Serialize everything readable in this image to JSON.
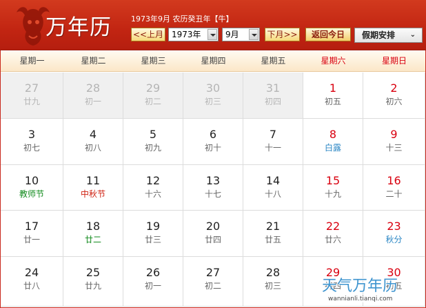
{
  "header": {
    "logo_text": "万年历",
    "ganzhi_text": "1973年9月 农历癸丑年【牛】",
    "prev_month_label": "<<上月",
    "year_value": "1973年",
    "month_value": "9月",
    "next_month_label": "下月>>",
    "today_label": "返回今日",
    "holiday_label": "假期安排",
    "holiday_caret": "⌄"
  },
  "weekdays": [
    "星期一",
    "星期二",
    "星期三",
    "星期四",
    "星期五",
    "星期六",
    "星期日"
  ],
  "weeks": [
    [
      {
        "num": "27",
        "lunar": "廿九"
      },
      {
        "num": "28",
        "lunar": "初一"
      },
      {
        "num": "29",
        "lunar": "初二"
      },
      {
        "num": "30",
        "lunar": "初三"
      },
      {
        "num": "31",
        "lunar": "初四"
      },
      {
        "num": "1",
        "lunar": "初五"
      },
      {
        "num": "2",
        "lunar": "初六"
      }
    ],
    [
      {
        "num": "3",
        "lunar": "初七"
      },
      {
        "num": "4",
        "lunar": "初八"
      },
      {
        "num": "5",
        "lunar": "初九"
      },
      {
        "num": "6",
        "lunar": "初十"
      },
      {
        "num": "7",
        "lunar": "十一"
      },
      {
        "num": "8",
        "lunar": "白露"
      },
      {
        "num": "9",
        "lunar": "十三"
      }
    ],
    [
      {
        "num": "10",
        "lunar": "教师节"
      },
      {
        "num": "11",
        "lunar": "中秋节"
      },
      {
        "num": "12",
        "lunar": "十六"
      },
      {
        "num": "13",
        "lunar": "十七"
      },
      {
        "num": "14",
        "lunar": "十八"
      },
      {
        "num": "15",
        "lunar": "十九"
      },
      {
        "num": "16",
        "lunar": "二十"
      }
    ],
    [
      {
        "num": "17",
        "lunar": "廿一"
      },
      {
        "num": "18",
        "lunar": "廿二"
      },
      {
        "num": "19",
        "lunar": "廿三"
      },
      {
        "num": "20",
        "lunar": "廿四"
      },
      {
        "num": "21",
        "lunar": "廿五"
      },
      {
        "num": "22",
        "lunar": "廿六"
      },
      {
        "num": "23",
        "lunar": "秋分"
      }
    ],
    [
      {
        "num": "24",
        "lunar": "廿八"
      },
      {
        "num": "25",
        "lunar": "廿九"
      },
      {
        "num": "26",
        "lunar": "初一"
      },
      {
        "num": "27",
        "lunar": "初二"
      },
      {
        "num": "28",
        "lunar": "初三"
      },
      {
        "num": "29",
        "lunar": "初四"
      },
      {
        "num": "30",
        "lunar": "初五"
      }
    ]
  ],
  "watermark": {
    "title": "天气万年历",
    "url": "wannianli.tianqi.com"
  },
  "colors": {
    "header_red": "#c22512",
    "weekend_red": "#d9000f",
    "solar_term_blue": "#2a86c4",
    "festival_green": "#118a1c",
    "festival_red": "#cf1e0e"
  }
}
